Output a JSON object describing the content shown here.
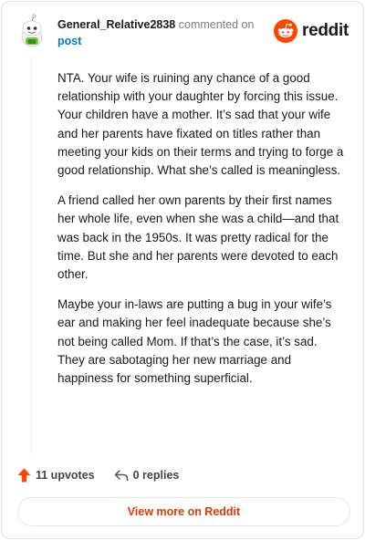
{
  "comment": {
    "username": "General_Relative2838",
    "action_text": "commented on",
    "target_link": "post",
    "paragraphs": [
      "NTA. Your wife is ruining any chance of a good relationship with your daughter by forcing this issue. Your children have a mother. It’s sad that your wife and her parents have fixated on titles rather than meeting your kids on their terms and trying to forge a good relationship. What she’s called is meaningless.",
      "A friend called her own parents by their first names her whole life, even when she was a child—and that was back in the 1950s. It was pretty radical for the time. But she and her parents were devoted to each other.",
      "Maybe your in-laws are putting a bug in your wife’s ear and making her feel inadequate because she’s not being called Mom. If that’s the case, it’s sad. They are sabotaging her new marriage and happiness for something superficial."
    ]
  },
  "brand": {
    "name": "reddit",
    "icon": "reddit-logo-icon",
    "color": "#ff4500"
  },
  "actions": {
    "upvotes_label": "11 upvotes",
    "replies_label": "0 replies",
    "upvote_icon": "upvote-arrow-icon",
    "reply_icon": "reply-arrow-icon"
  },
  "footer": {
    "view_more_label": "View more on Reddit"
  },
  "colors": {
    "accent": "#ff4500",
    "link": "#0079d3",
    "cta": "#d93a00"
  }
}
